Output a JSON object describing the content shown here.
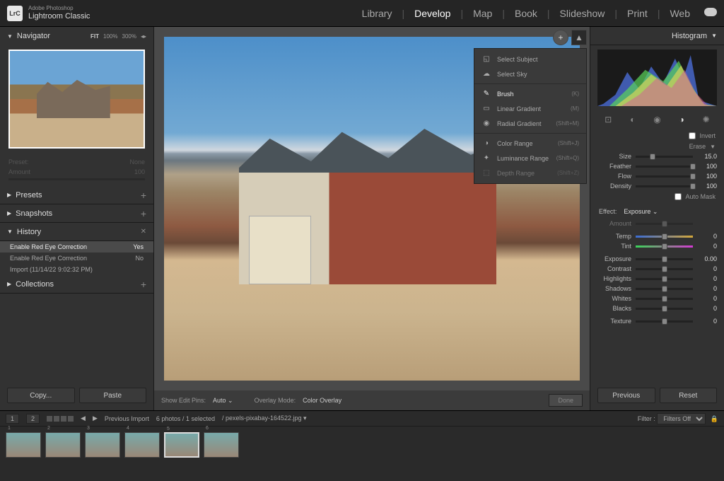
{
  "brand": {
    "top": "Adobe Photoshop",
    "name": "Lightroom Classic",
    "logo": "LrC"
  },
  "modules": [
    "Library",
    "Develop",
    "Map",
    "Book",
    "Slideshow",
    "Print",
    "Web"
  ],
  "active_module": "Develop",
  "navigator": {
    "title": "Navigator",
    "fit": "FIT",
    "zoom1": "100%",
    "zoom2": "300%",
    "preset_label": "Preset:",
    "preset_value": "None",
    "amount_label": "Amount",
    "amount_value": "100"
  },
  "left_panels": {
    "presets": "Presets",
    "snapshots": "Snapshots",
    "history": "History",
    "collections": "Collections"
  },
  "history": [
    {
      "label": "Enable Red Eye Correction",
      "val": "Yes",
      "sel": true
    },
    {
      "label": "Enable Red Eye Correction",
      "val": "No",
      "sel": false
    },
    {
      "label": "Import (11/14/22 9:02:32 PM)",
      "val": "",
      "sel": false
    }
  ],
  "left_buttons": {
    "copy": "Copy...",
    "paste": "Paste"
  },
  "center_footer": {
    "pins_label": "Show Edit Pins:",
    "pins_value": "Auto",
    "overlay_label": "Overlay Mode:",
    "overlay_value": "Color Overlay",
    "done": "Done"
  },
  "mask_menu": [
    {
      "icon": "◱",
      "label": "Select Subject",
      "shortcut": ""
    },
    {
      "icon": "☁",
      "label": "Select Sky",
      "shortcut": ""
    },
    {
      "sep": true
    },
    {
      "icon": "✎",
      "label": "Brush",
      "shortcut": "(K)",
      "sel": true
    },
    {
      "icon": "▭",
      "label": "Linear Gradient",
      "shortcut": "(M)"
    },
    {
      "icon": "◉",
      "label": "Radial Gradient",
      "shortcut": "(Shift+M)"
    },
    {
      "sep": true
    },
    {
      "icon": "◑",
      "label": "Color Range",
      "shortcut": "(Shift+J)"
    },
    {
      "icon": "✦",
      "label": "Luminance Range",
      "shortcut": "(Shift+Q)"
    },
    {
      "icon": "⬚",
      "label": "Depth Range",
      "shortcut": "(Shift+Z)",
      "dim": true
    }
  ],
  "right": {
    "histogram": "Histogram",
    "invert": "Invert",
    "erase": "Erase",
    "brush": [
      {
        "label": "Size",
        "val": "15.0",
        "pos": 30
      },
      {
        "label": "Feather",
        "val": "100",
        "pos": 100
      },
      {
        "label": "Flow",
        "val": "100",
        "pos": 100
      },
      {
        "label": "Density",
        "val": "100",
        "pos": 100
      }
    ],
    "automask": "Auto Mask",
    "effect_label": "Effect:",
    "effect_value": "Exposure",
    "amount": {
      "label": "Amount",
      "val": "",
      "pos": 50
    },
    "temp": {
      "label": "Temp",
      "val": "0",
      "pos": 50
    },
    "tint": {
      "label": "Tint",
      "val": "0",
      "pos": 50
    },
    "tone": [
      {
        "label": "Exposure",
        "val": "0.00",
        "pos": 50
      },
      {
        "label": "Contrast",
        "val": "0",
        "pos": 50
      },
      {
        "label": "Highlights",
        "val": "0",
        "pos": 50
      },
      {
        "label": "Shadows",
        "val": "0",
        "pos": 50
      },
      {
        "label": "Whites",
        "val": "0",
        "pos": 50
      },
      {
        "label": "Blacks",
        "val": "0",
        "pos": 50
      }
    ],
    "texture": {
      "label": "Texture",
      "val": "0",
      "pos": 50
    },
    "buttons": {
      "prev": "Previous",
      "reset": "Reset"
    }
  },
  "filmstrip": {
    "pages": [
      "1",
      "2"
    ],
    "nav_label": "Previous Import",
    "count": "6 photos / 1 selected",
    "path": "/ pexels-pixabay-164522.jpg ▾",
    "filter_label": "Filter :",
    "filter_value": "Filters Off",
    "thumbs": 6,
    "selected": 5
  }
}
